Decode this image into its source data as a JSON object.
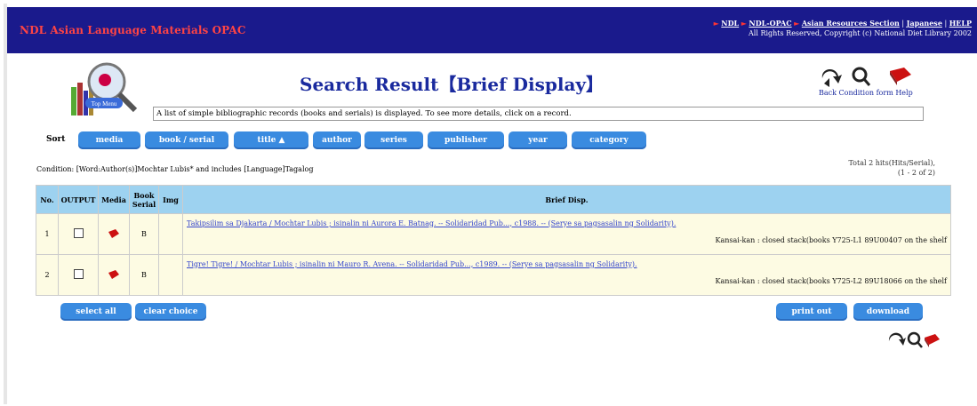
{
  "header": {
    "app_title": "NDL Asian Language Materials OPAC",
    "links": [
      "NDL",
      "NDL-OPAC",
      "Asian Resources Section",
      "Japanese",
      "HELP"
    ],
    "copyright": "All Rights Reserved, Copyright (c) National Diet Library 2002"
  },
  "logo_text": "Top Menu",
  "page_title": "Search Result【Brief Display】",
  "tools": {
    "back_label": "Back",
    "condition_label": "Condition",
    "form_label": "form",
    "help_label": "Help"
  },
  "description": "A list of simple bibliographic records (books and serials) is displayed. To see more details, click on a record.",
  "sort": {
    "label": "Sort",
    "buttons": [
      "media",
      "book / serial",
      "title ▲",
      "author",
      "series",
      "publisher",
      "year",
      "category"
    ]
  },
  "condition": "Condition: [Word:Author(s)]Mochtar Lubis* and includes [Language]Tagalog",
  "total": {
    "line1": "Total 2 hits(Hits/Serial),",
    "line2": "(1 - 2 of 2)"
  },
  "table": {
    "headers": [
      "No.",
      "OUTPUT",
      "Media",
      "Book Serial",
      "Img",
      "Brief Disp."
    ],
    "rows": [
      {
        "no": "1",
        "book_serial": "B",
        "record": "Takipsilim sa Djakarta / Mochtar Lubis ; isinalin ni Aurora E. Batnag. -- Solidaridad Pub..., c1988. -- (Serye sa pagsasalin ng Solidarity).",
        "holding": "Kansai-kan : closed stack(books   Y725-L1   89U00407   on the shelf"
      },
      {
        "no": "2",
        "book_serial": "B",
        "record": "Tigre! Tigre! / Mochtar Lubis ; isinalin ni Mauro R. Avena. -- Solidaridad Pub..., c1989. -- (Serye sa pagsasalin ng Solidarity).",
        "holding": "Kansai-kan : closed stack(books   Y725-L2   89U18066   on the shelf"
      }
    ]
  },
  "actions": {
    "select_all": "select all",
    "clear_choice": "clear choice",
    "print_out": "print out",
    "download": "download"
  },
  "colors": {
    "header_bg": "#1a1a8c",
    "button_blue": "#3a8be0",
    "table_head": "#9dd2f0",
    "row_bg": "#fdfbe3"
  }
}
